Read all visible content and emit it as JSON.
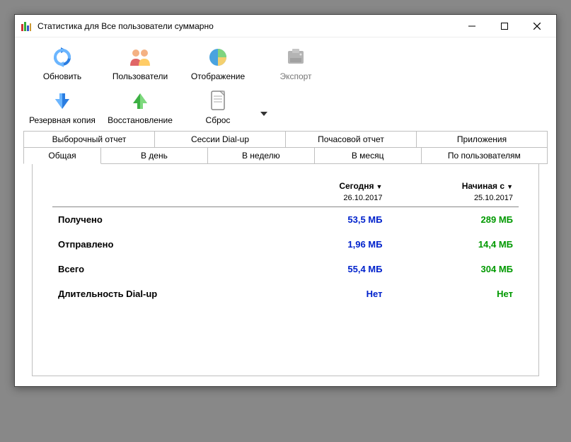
{
  "window": {
    "title": "Статистика для Все пользователи суммарно"
  },
  "toolbar": {
    "refresh": "Обновить",
    "users": "Пользователи",
    "display": "Отображение",
    "export": "Экспорт",
    "backup": "Резервная копия",
    "restore": "Восстановление",
    "reset": "Сброс"
  },
  "tabs_row1": {
    "selective": "Выборочный отчет",
    "dialup": "Сессии Dial-up",
    "hourly": "Почасовой отчет",
    "apps": "Приложения"
  },
  "tabs_row2": {
    "general": "Общая",
    "perday": "В день",
    "perweek": "В неделю",
    "permonth": "В месяц",
    "peruser": "По пользователям"
  },
  "stats": {
    "header_today": "Сегодня",
    "header_since": "Начиная с",
    "date_today": "26.10.2017",
    "date_since": "25.10.2017",
    "rows": {
      "received": {
        "label": "Получено",
        "today": "53,5 МБ",
        "since": "289 МБ"
      },
      "sent": {
        "label": "Отправлено",
        "today": "1,96 МБ",
        "since": "14,4 МБ"
      },
      "total": {
        "label": "Всего",
        "today": "55,4 МБ",
        "since": "304 МБ"
      },
      "dialup": {
        "label": "Длительность Dial-up",
        "today": "Нет",
        "since": "Нет"
      }
    }
  }
}
